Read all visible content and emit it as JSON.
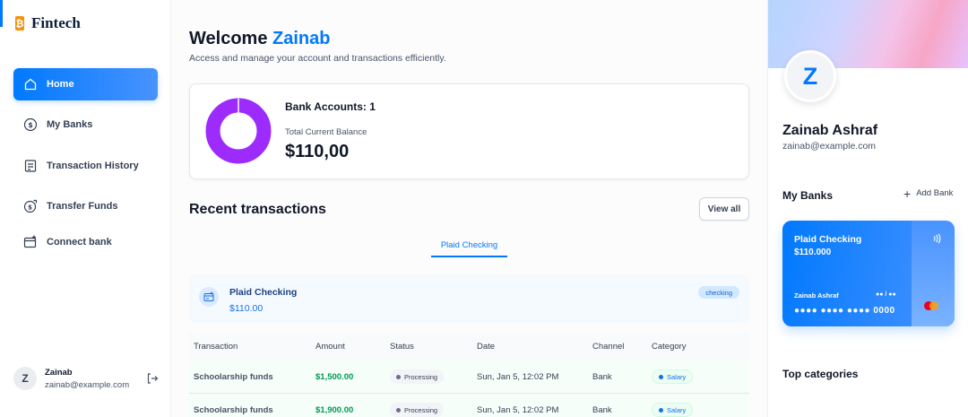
{
  "sidebar": {
    "logo": "Fintech",
    "nav": [
      {
        "label": "Home",
        "icon": "home-icon",
        "active": true
      },
      {
        "label": "My Banks",
        "icon": "dollar-circle-icon"
      },
      {
        "label": "Transaction History",
        "icon": "receipt-icon"
      },
      {
        "label": "Transfer Funds",
        "icon": "money-send-icon"
      },
      {
        "label": "Connect bank",
        "icon": "card-add-icon"
      }
    ],
    "footer": {
      "avatar": "Z",
      "name": "Zainab",
      "email": "zainab@example.com",
      "logout_icon": "logout-icon"
    }
  },
  "header": {
    "greeting": "Welcome",
    "name": "Zainab",
    "subtitle": "Access and manage your account and transactions efficiently."
  },
  "balance": {
    "bank_accounts": "Bank Accounts: 1",
    "total_label": "Total Current Balance",
    "total_value": "$110,00",
    "donut_color": "#9d2cfc"
  },
  "recent": {
    "title": "Recent transactions",
    "view_all": "View all",
    "tab": "Plaid Checking",
    "bank": {
      "name": "Plaid Checking",
      "balance": "$110.00",
      "badge": "checking"
    },
    "columns": [
      "Transaction",
      "Amount",
      "Status",
      "Date",
      "Channel",
      "Category"
    ],
    "rows": [
      {
        "transaction": "Schoolarship funds",
        "amount": "$1,500.00",
        "status": "Processing",
        "date": "Sun, Jan 5, 12:02 PM",
        "channel": "Bank",
        "category": "Salary"
      },
      {
        "transaction": "Schoolarship funds",
        "amount": "$1,900.00",
        "status": "Processing",
        "date": "Sun, Jan 5, 12:02 PM",
        "channel": "Bank",
        "category": "Salary"
      }
    ]
  },
  "profile": {
    "avatar": "Z",
    "name": "Zainab Ashraf",
    "email": "zainab@example.com"
  },
  "my_banks": {
    "title": "My Banks",
    "add_bank": "Add Bank",
    "card": {
      "name": "Plaid Checking",
      "balance": "$110.000",
      "holder": "Zainab Ashraf",
      "expiry": "●● / ●●",
      "number": "●●●● ●●●● ●●●● 0000"
    }
  },
  "top_categories": {
    "title": "Top categories"
  },
  "colors": {
    "accent": "#0179fe",
    "amount_green": "#039855"
  }
}
